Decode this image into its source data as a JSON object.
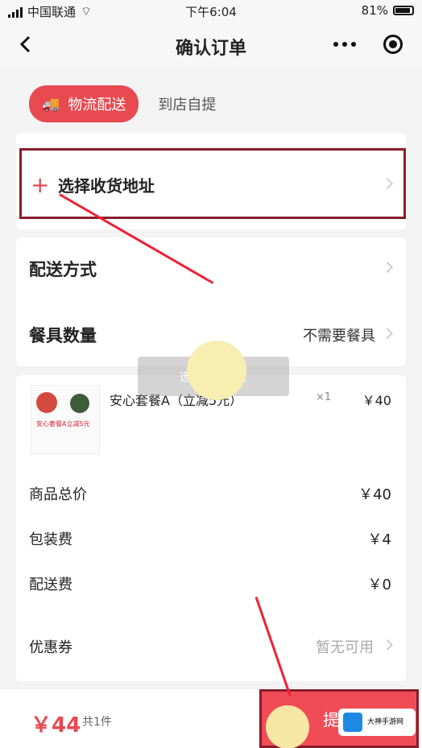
{
  "status_bar": {
    "carrier": "中国联通",
    "time": "下午6:04",
    "battery": "81%"
  },
  "nav": {
    "title": "确认订单"
  },
  "tabs": {
    "delivery": "物流配送",
    "pickup": "到店自提"
  },
  "address": {
    "label": "选择收货地址"
  },
  "delivery": {
    "method_label": "配送方式",
    "tableware_label": "餐具数量",
    "tableware_value": "不需要餐具"
  },
  "product": {
    "name": "安心套餐A（立减5元）",
    "quantity": "×1",
    "price": "￥40",
    "thumb_text": "安心套餐A立减5元"
  },
  "fees": {
    "total_label": "商品总价",
    "total_value": "￥40",
    "packaging_label": "包装费",
    "packaging_value": "￥4",
    "shipping_label": "配送费",
    "shipping_value": "￥0",
    "coupon_label": "优惠券",
    "coupon_value": "暂无可用"
  },
  "bottom": {
    "total": "￥44",
    "count": "共1件",
    "submit": "提交"
  },
  "watermark": {
    "text": "大神手游网"
  },
  "overlay": {
    "text": "选择收货地址"
  }
}
